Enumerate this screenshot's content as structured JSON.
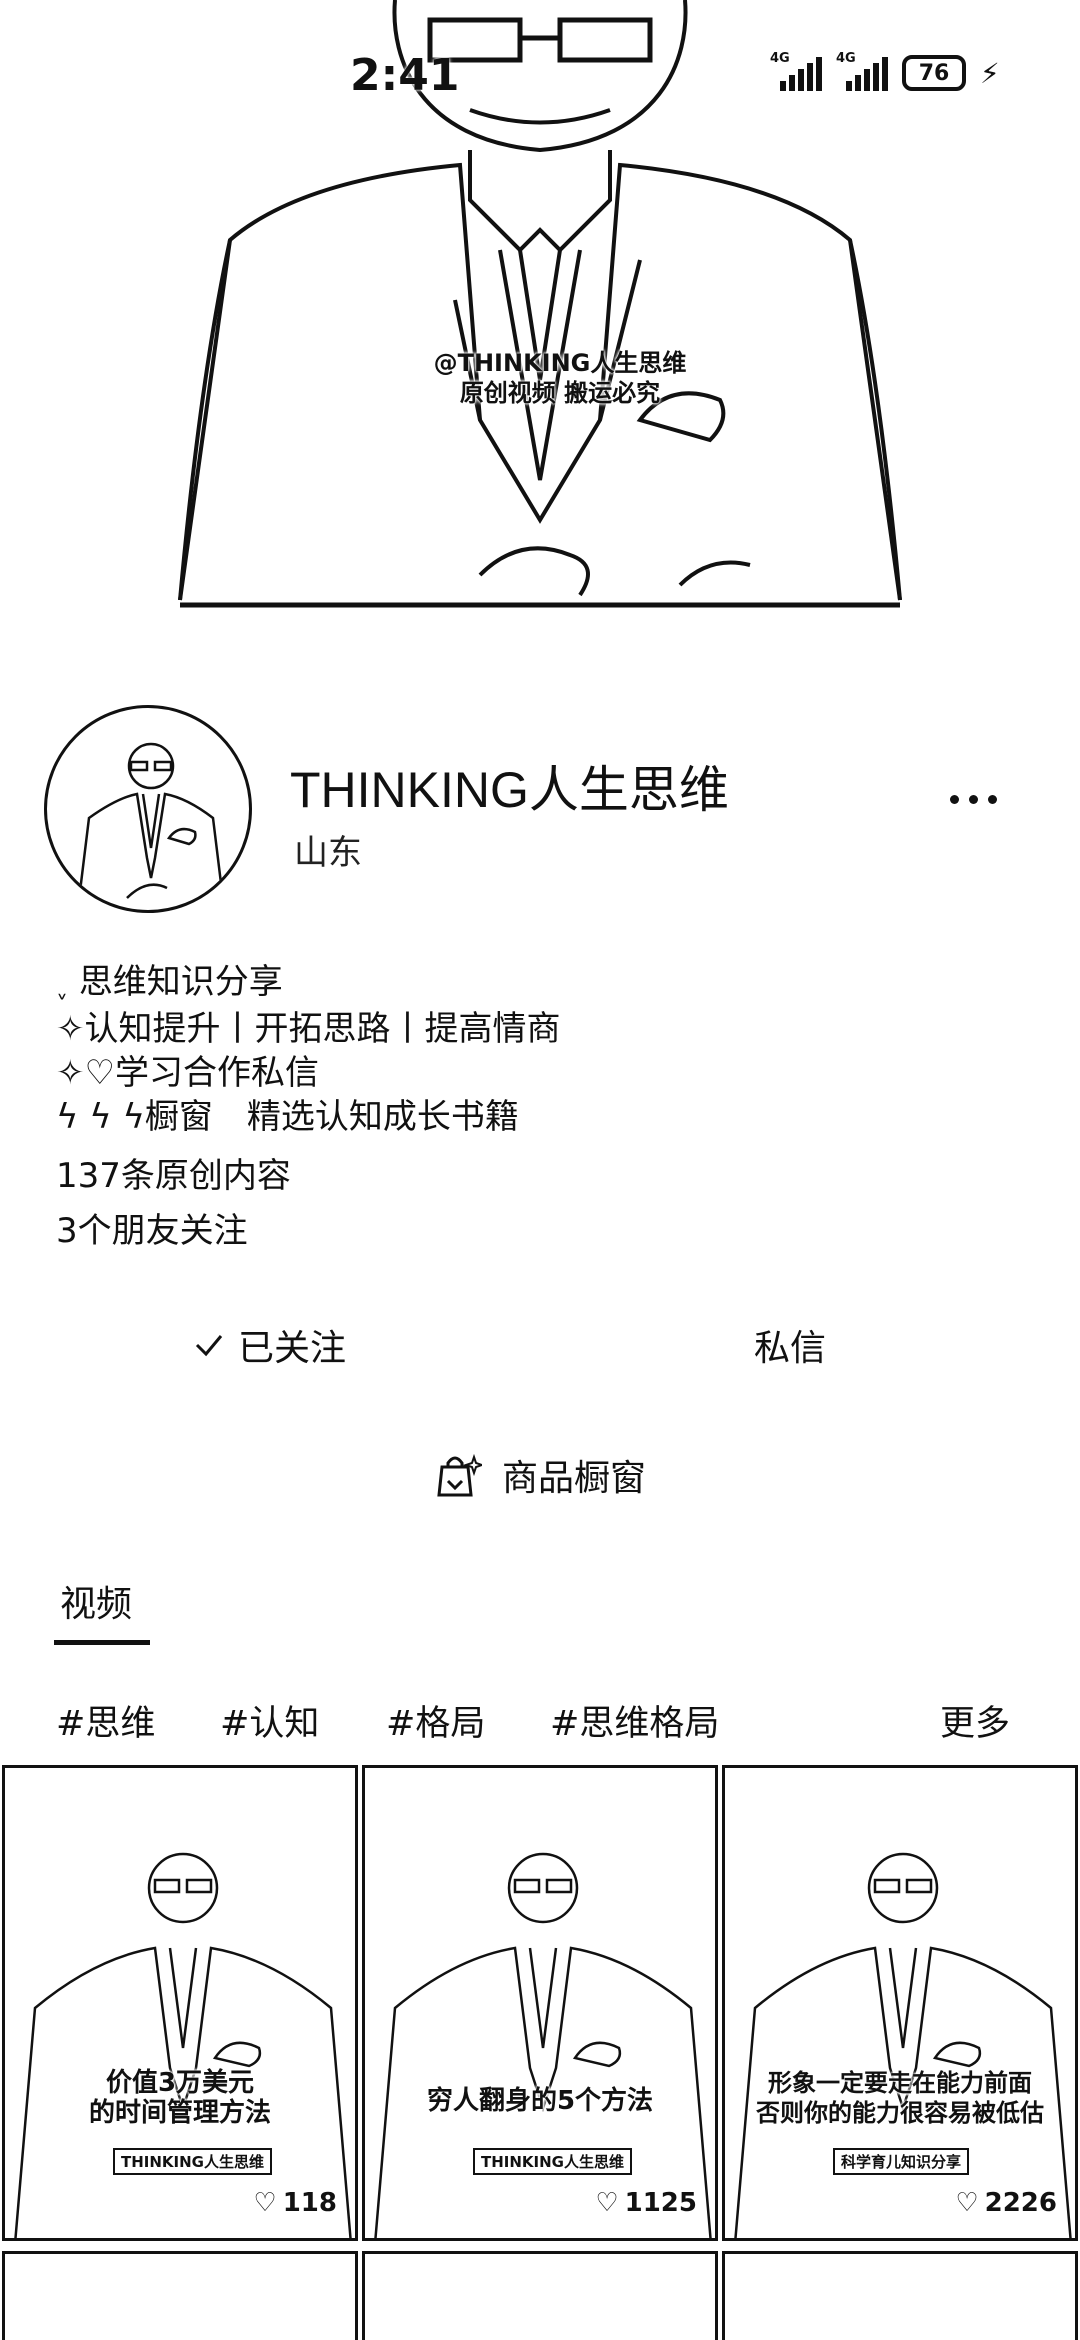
{
  "status_bar": {
    "time": "2:41",
    "network1": "4G",
    "network2": "4G",
    "battery": "76"
  },
  "cover": {
    "watermark_line1": "@THINKING人生思维",
    "watermark_line2": "原创视频 搬运必究"
  },
  "profile": {
    "name": "THINKING人生思维",
    "location": "山东",
    "bio": [
      "思维知识分享",
      "认知提升丨开拓思路丨提高情商",
      "学习合作私信",
      "橱窗　精选认知成长书籍"
    ],
    "original_count": "137条原创内容",
    "friends_follow": "3个朋友关注"
  },
  "actions": {
    "follow_label": "已关注",
    "message_label": "私信",
    "shop_label": "商品橱窗"
  },
  "tabs": {
    "video_label": "视频"
  },
  "tags": [
    "#思维",
    "#认知",
    "#格局",
    "#思维格局"
  ],
  "tags_more": "更多",
  "videos": [
    {
      "caption1": "价值3万美元",
      "caption2": "的时间管理方法",
      "brand": "THINKING人生思维",
      "likes": "118"
    },
    {
      "caption1": "穷人翻身的5个方法",
      "caption2": "",
      "brand": "THINKING人生思维",
      "likes": "1125"
    },
    {
      "caption1": "形象一定要走在能力前面",
      "caption2": "否则你的能力很容易被低估",
      "brand": "科学育儿知识分享",
      "likes": "2226"
    }
  ]
}
